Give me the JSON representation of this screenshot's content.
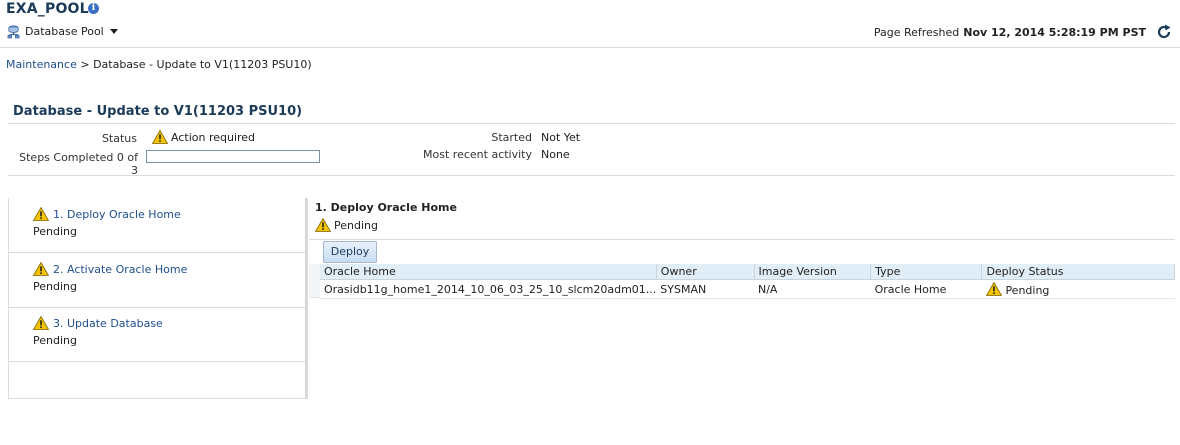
{
  "header": {
    "title": "EXA_POOL",
    "pool_menu_label": "Database Pool",
    "refresh_label": "Page Refreshed",
    "refresh_time": "Nov 12, 2014 5:28:19 PM PST"
  },
  "breadcrumb": {
    "parent": "Maintenance",
    "separator": ">",
    "current": "Database - Update to V1(11203 PSU10)"
  },
  "summary": {
    "title": "Database - Update to V1(11203 PSU10)",
    "status_label": "Status",
    "status_value": "Action required",
    "steps_label": "Steps Completed 0 of 3",
    "progress_fraction": 0,
    "started_label": "Started",
    "started_value": "Not Yet",
    "recent_label": "Most recent activity",
    "recent_value": "None"
  },
  "steps": [
    {
      "label": "1. Deploy Oracle Home",
      "state": "Pending"
    },
    {
      "label": "2. Activate Oracle Home",
      "state": "Pending"
    },
    {
      "label": "3. Update Database",
      "state": "Pending"
    }
  ],
  "detail": {
    "title": "1. Deploy Oracle Home",
    "status": "Pending",
    "deploy_button": "Deploy",
    "columns": [
      "Oracle Home",
      "Owner",
      "Image Version",
      "Type",
      "Deploy Status"
    ],
    "rows": [
      {
        "oracle_home": "Orasidb11g_home1_2014_10_06_03_25_10_slcm20adm01...",
        "owner": "SYSMAN",
        "image_version": "N/A",
        "type": "Oracle Home",
        "deploy_status": "Pending"
      }
    ]
  },
  "colors": {
    "accent": "#1c3b5a",
    "link": "#1f4e8c",
    "warning": "#f5c400",
    "grid_header": "#e2eef7"
  },
  "icons": [
    "info-icon",
    "database-pool-icon",
    "chevron-down-icon",
    "refresh-icon",
    "warning-icon"
  ]
}
